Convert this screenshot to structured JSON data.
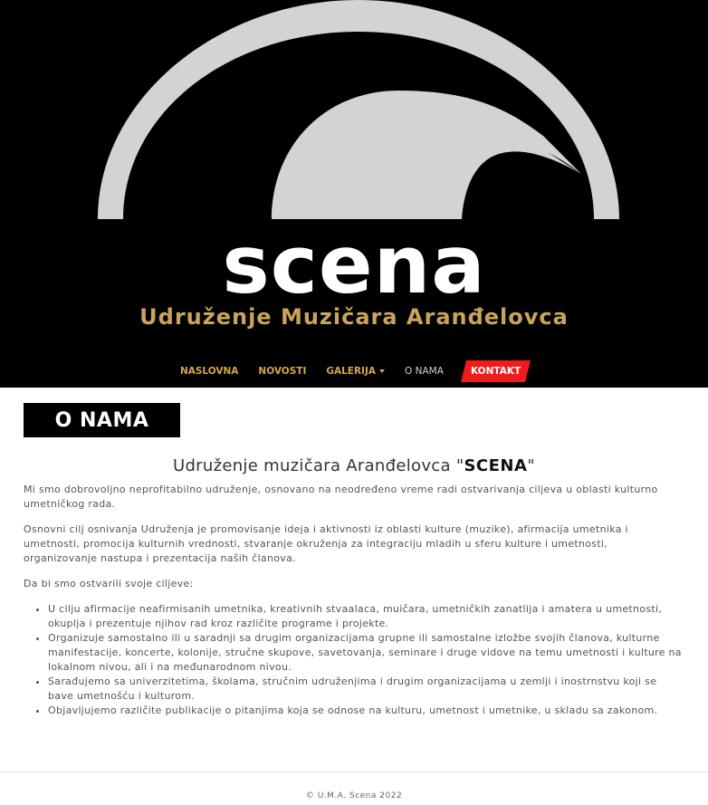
{
  "header": {
    "brand_word": "scena",
    "subtitle": "Udruženje Muzičara Aranđelovca",
    "accent_color": "#c9a45a",
    "logo_icon": "scena-dome-logo-icon"
  },
  "nav": {
    "items": [
      {
        "label": "NASLOVNA"
      },
      {
        "label": "NOVOSTI"
      },
      {
        "label": "GALERIJA"
      },
      {
        "label": "O NAMA"
      },
      {
        "label": "KONTAKT"
      }
    ],
    "contact_color": "#ee1c1c"
  },
  "section": {
    "tag": "O NAMA"
  },
  "main": {
    "heading_prefix": "Udruženje muzičara Aranđelovca \"",
    "heading_bold": "SCENA",
    "heading_suffix": "\"",
    "intro": "Mi smo dobrovoljno neprofitabilno udruženje, osnovano na neodređeno vreme radi ostvarivanja ciljeva u oblasti kulturno umetničkog rada.",
    "goal": "Osnovni cilj osnivanja Udruženja je promovisanje ideja i aktivnosti iz oblasti kulture (muzike), afirmacija umetnika i umetnosti, promocija kulturnih vrednosti, stvaranje okruženja za integraciju mladih u sferu kulture i umetnosti, organizovanje nastupa i prezentacija naših članova.",
    "list_intro": "Da bi smo ostvarili svoje ciljeve:",
    "list": [
      "U cilju afirmacije neafirmisanih umetnika, kreativnih stvaalaca, muičara, umetničkih zanatlija i amatera u umetnosti, okuplja i prezentuje njihov rad kroz različite programe i projekte.",
      "Organizuje samostalno ili u saradnji sa drugim organizacijama grupne ili samostalne izložbe svojih članova, kulturne manifestacije, koncerte, kolonije, stručne skupove, savetovanja, seminare i druge vidove na temu umetnosti i kulture na lokalnom nivou, ali i na međunarodnom nivou.",
      "Sarađujemo sa univerzitetima, školama, stručnim udruženjima i  drugim organizacijama u zemlji i inostrnstvu koji se bave umetnošću i kulturom.",
      "Objavljujemo različite publikacije o pitanjima koja se odnose na kulturu, umetnost i umetnike, u skladu sa zakonom."
    ]
  },
  "footer": {
    "text": "© U.M.A. Scena 2022"
  }
}
